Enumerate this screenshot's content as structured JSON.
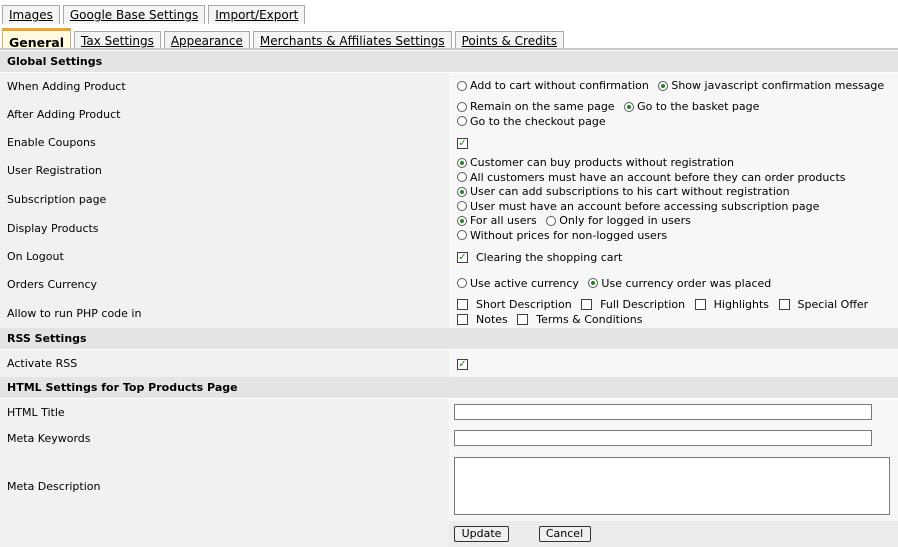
{
  "tabs_row1": [
    {
      "label": "Images"
    },
    {
      "label": "Google Base Settings"
    },
    {
      "label": "Import/Export"
    }
  ],
  "tabs_row2": [
    {
      "label": "General",
      "active": true
    },
    {
      "label": "Tax Settings"
    },
    {
      "label": "Appearance"
    },
    {
      "label": "Merchants & Affiliates Settings"
    },
    {
      "label": "Points & Credits"
    }
  ],
  "sections": {
    "global": "Global Settings",
    "rss": "RSS Settings",
    "html": "HTML Settings for Top Products Page"
  },
  "global": {
    "adding_product": {
      "label": "When Adding Product",
      "options": [
        "Add to cart without confirmation",
        "Show javascript confirmation message"
      ],
      "selected": 1
    },
    "after_adding": {
      "label": "After Adding Product",
      "options": [
        "Remain on the same page",
        "Go to the basket page",
        "Go to the checkout page"
      ],
      "selected": 1
    },
    "coupons": {
      "label": "Enable Coupons",
      "checked": true
    },
    "registration": {
      "label": "User Registration",
      "options": [
        "Customer can buy products without registration",
        "All customers must have an account before they can order products"
      ],
      "selected": 0
    },
    "subscription": {
      "label": "Subscription page",
      "options": [
        "User can add subscriptions to his cart without registration",
        "User must have an account before accessing subscription page"
      ],
      "selected": 0
    },
    "display": {
      "label": "Display Products",
      "options": [
        "For all users",
        "Only for logged in users",
        "Without prices for non-logged users"
      ],
      "selected": 0
    },
    "logout": {
      "label": "On Logout",
      "option": "Clearing the shopping cart",
      "checked": true
    },
    "currency": {
      "label": "Orders Currency",
      "options": [
        "Use active currency",
        "Use currency order was placed"
      ],
      "selected": 1
    },
    "php": {
      "label": "Allow to run PHP code in",
      "options": [
        "Short Description",
        "Full Description",
        "Highlights",
        "Special Offer",
        "Notes",
        "Terms & Conditions"
      ]
    }
  },
  "rss": {
    "activate": {
      "label": "Activate RSS",
      "checked": true
    }
  },
  "html": {
    "title": {
      "label": "HTML Title",
      "value": ""
    },
    "keywords": {
      "label": "Meta Keywords",
      "value": ""
    },
    "description": {
      "label": "Meta Description",
      "value": ""
    }
  },
  "buttons": {
    "update": "Update",
    "cancel": "Cancel"
  },
  "colors": {
    "active_tab_top": "#f0a030",
    "check_mark": "#1a8a1a",
    "section_bg": "#e4e4e4"
  }
}
